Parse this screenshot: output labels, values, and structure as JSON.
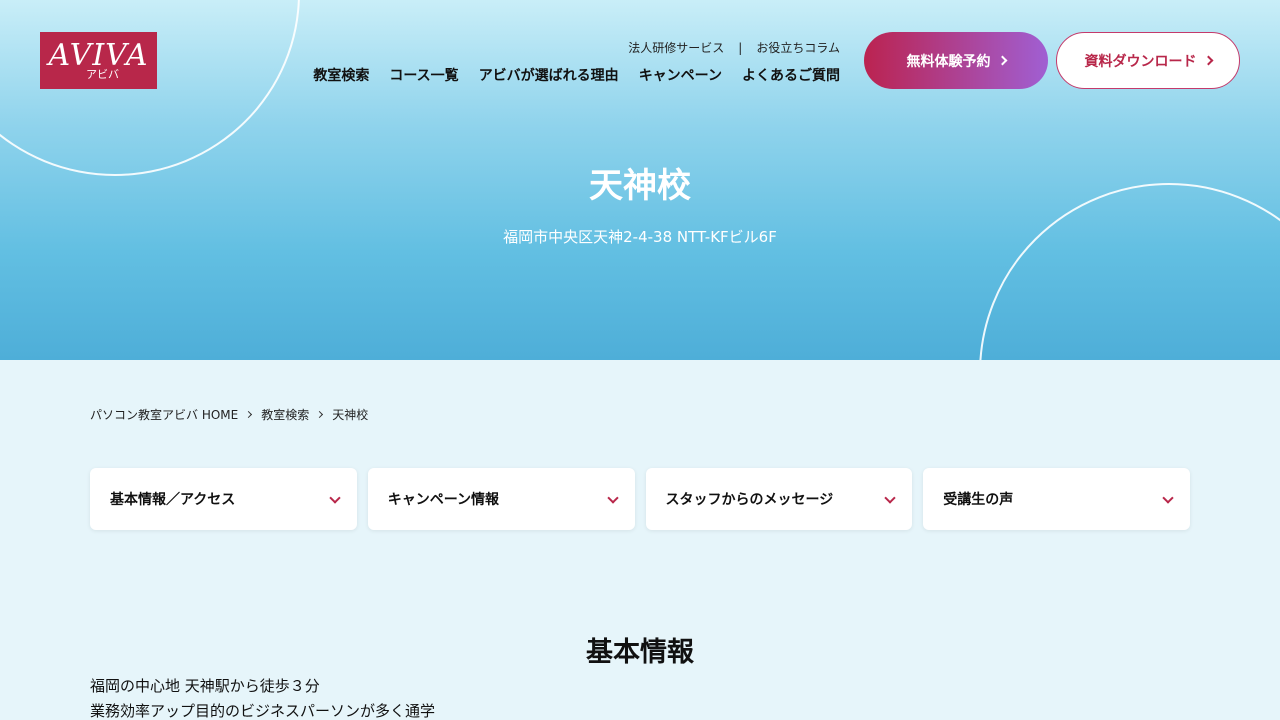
{
  "logo": {
    "main": "AVIVA",
    "sub": "アビバ"
  },
  "util_nav": {
    "items": [
      "法人研修サービス",
      "お役立ちコラム"
    ],
    "separator": "|"
  },
  "main_nav": {
    "items": [
      "教室検索",
      "コース一覧",
      "アビバが選ばれる理由",
      "キャンペーン",
      "よくあるご質問"
    ]
  },
  "buttons": {
    "trial": "無料体験予約",
    "download": "資料ダウンロード"
  },
  "hero": {
    "title": "天神校",
    "address": "福岡市中央区天神2-4-38 NTT-KFビル6F"
  },
  "breadcrumb": [
    "パソコン教室アビバ HOME",
    "教室検索",
    "天神校"
  ],
  "tabs": [
    "基本情報／アクセス",
    "キャンペーン情報",
    "スタッフからのメッセージ",
    "受講生の声"
  ],
  "section": {
    "title": "基本情報",
    "lines": [
      "福岡の中心地 天神駅から徒歩３分",
      "業務効率アップ目的のビジネスパーソンが多く通学"
    ]
  },
  "colors": {
    "brand": "#b8274a",
    "accent_gradient_end": "#a05fd3",
    "page_bg": "#e6f5fa"
  }
}
